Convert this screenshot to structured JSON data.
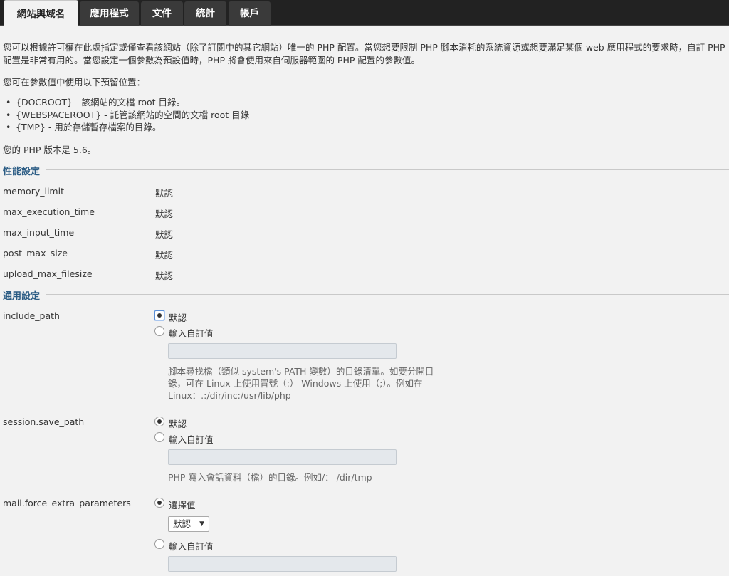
{
  "tabs": [
    {
      "label": "網站與域名",
      "active": true
    },
    {
      "label": "應用程式"
    },
    {
      "label": "文件"
    },
    {
      "label": "統計"
    },
    {
      "label": "帳戶"
    }
  ],
  "intro": {
    "paragraph": "您可以根據許可權在此處指定或僅查看該網站（除了訂閱中的其它網站）唯一的 PHP 配置。當您想要限制 PHP 腳本消耗的系統資源或想要滿足某個 web 應用程式的要求時，自訂 PHP 配置是非常有用的。當您設定一個參數為預設值時，PHP 將會使用來自伺服器範圍的 PHP 配置的參數值。",
    "placeholders_intro": "您可在參數值中使用以下預留位置：",
    "placeholders": [
      "{DOCROOT} - 該網站的文檔 root 目錄。",
      "{WEBSPACEROOT} - 託管該網站的空間的文檔 root 目錄",
      "{TMP} - 用於存儲暫存檔案的目錄。"
    ],
    "version": "您的 PHP 版本是 5.6。"
  },
  "performance": {
    "title": "性能設定",
    "rows": [
      {
        "name": "memory_limit",
        "value": "默認"
      },
      {
        "name": "max_execution_time",
        "value": "默認"
      },
      {
        "name": "max_input_time",
        "value": "默認"
      },
      {
        "name": "post_max_size",
        "value": "默認"
      },
      {
        "name": "upload_max_filesize",
        "value": "默認"
      }
    ]
  },
  "general": {
    "title": "通用設定",
    "include_path": {
      "name": "include_path",
      "opt_default": "默認",
      "opt_custom": "輸入自訂值",
      "input_value": "",
      "hint_lines": [
        "腳本尋找檔（類似 system's PATH 變數）的目錄清單。如要分開目",
        "錄，可在 Linux 上使用冒號（:） Windows 上使用（;）。例如在",
        "Linux：.:/dir/inc:/usr/lib/php"
      ]
    },
    "session_save_path": {
      "name": "session.save_path",
      "opt_default": "默認",
      "opt_custom": "輸入自訂值",
      "input_value": "",
      "hint": "PHP 寫入會話資料（檔）的目錄。例如/： /dir/tmp"
    },
    "mail_force": {
      "name": "mail.force_extra_parameters",
      "opt_select": "選擇值",
      "select_value": "默認",
      "opt_custom": "輸入自訂值",
      "input_value": ""
    }
  }
}
